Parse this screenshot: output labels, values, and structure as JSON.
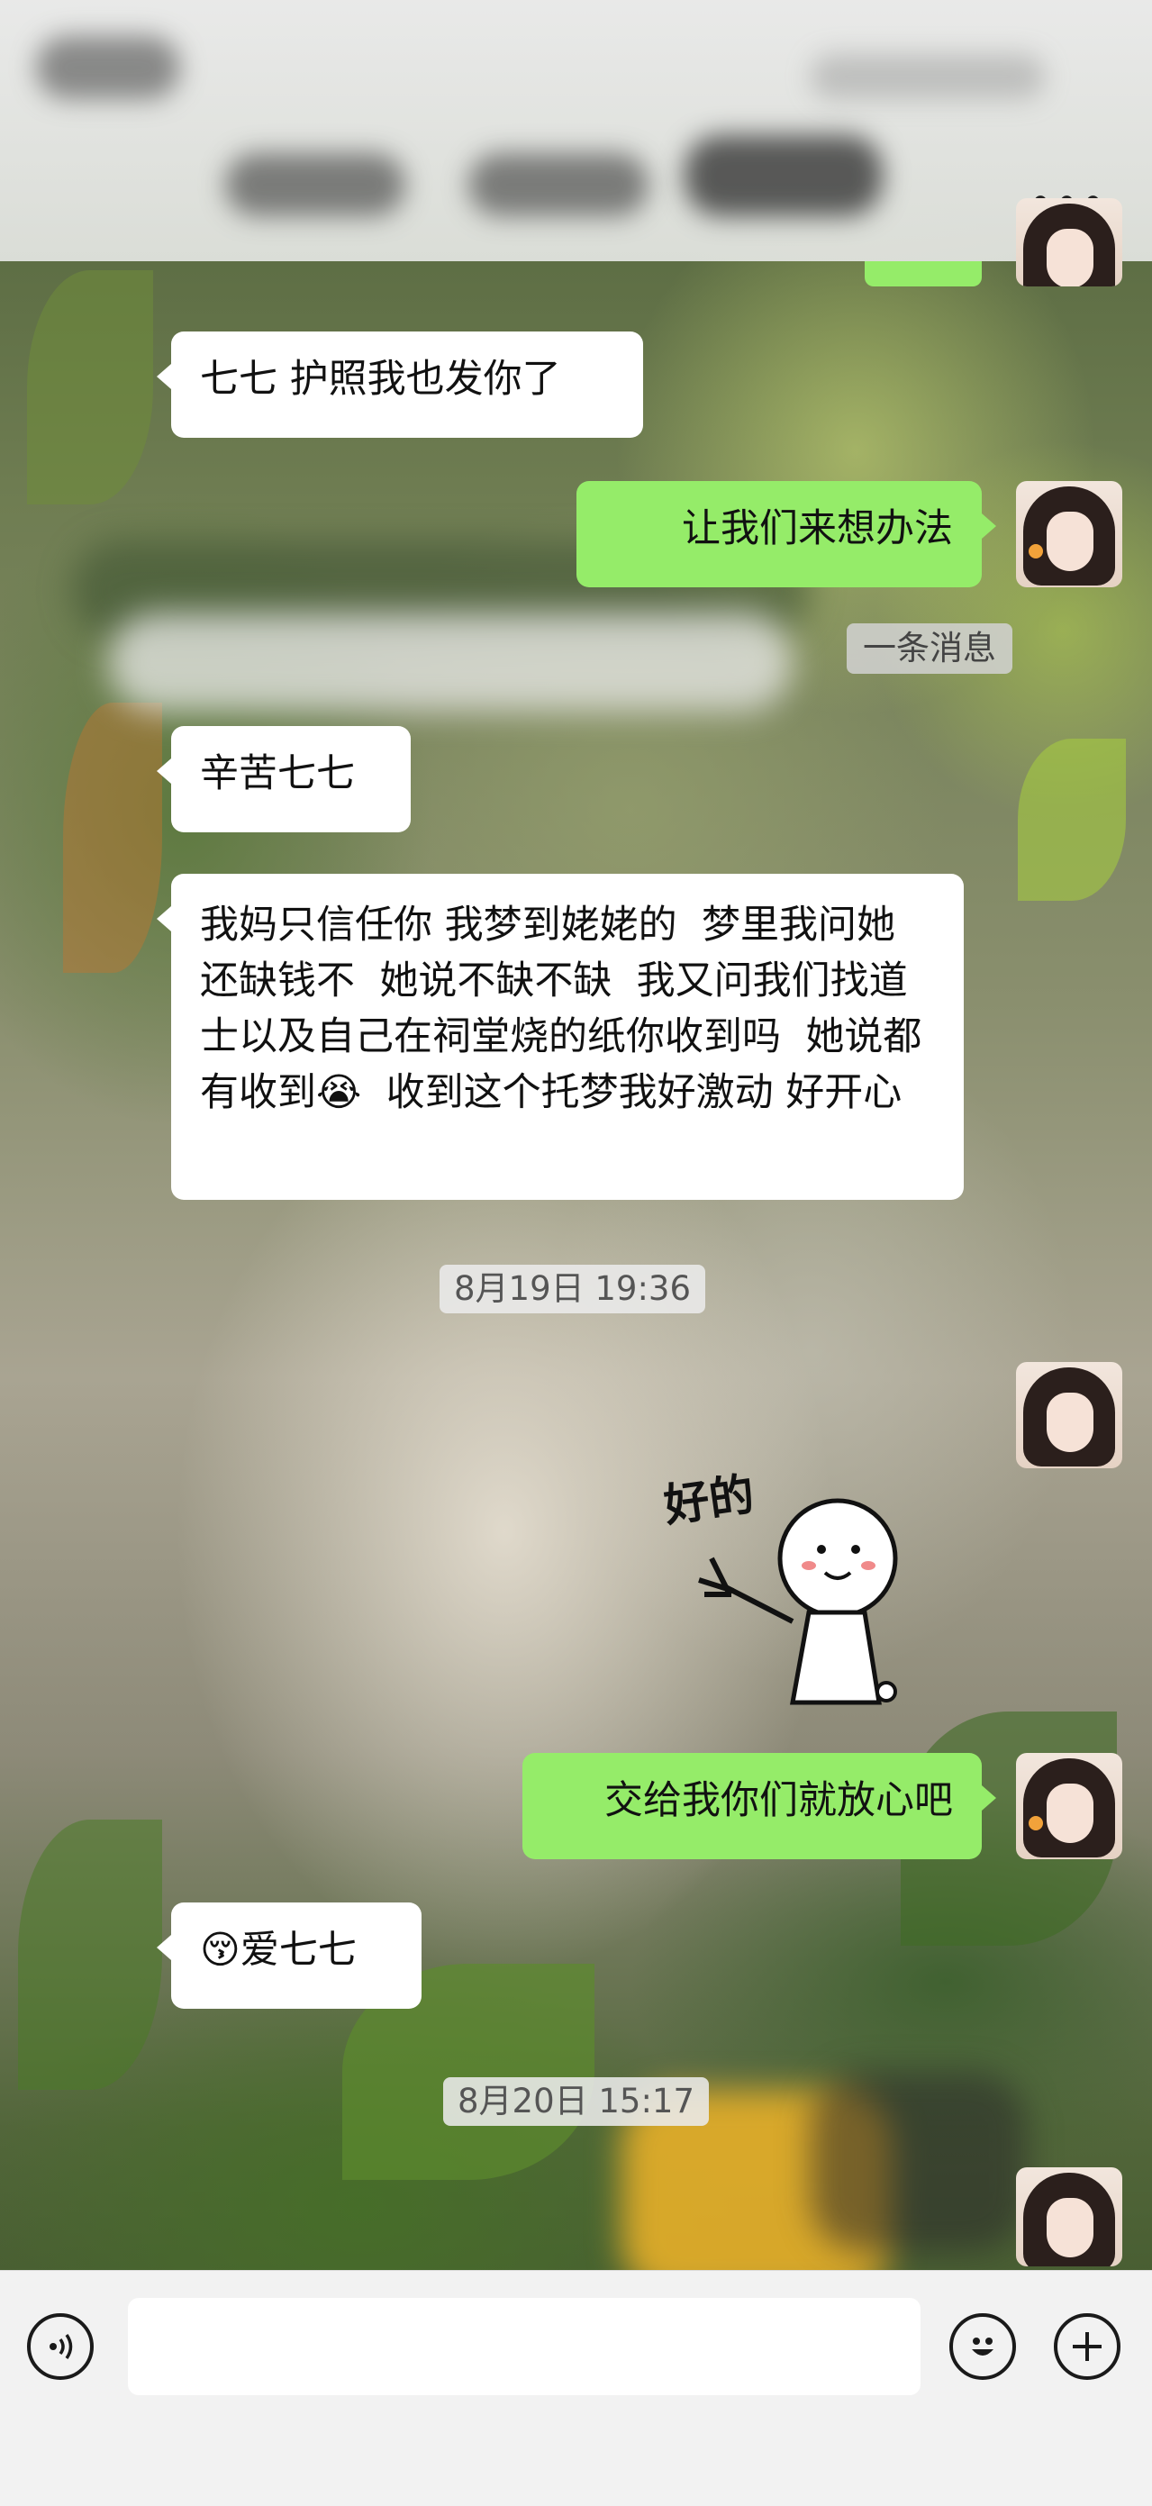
{
  "header": {
    "more_label": "•••",
    "more_icon": "more-dots-icon"
  },
  "messages": [
    {
      "id": "m1",
      "side": "in",
      "text": "七七 护照我也发你了"
    },
    {
      "id": "m2",
      "side": "out",
      "text": "让我们来想办法"
    },
    {
      "id": "m3",
      "side": "in",
      "text": "辛苦七七"
    },
    {
      "id": "m4",
      "side": "in",
      "text": "我妈只信任你 我梦到姥姥的  梦里我问她 还缺钱不  她说不缺不缺  我又问我们找道士以及自己在祠堂烧的纸你收到吗  她说都有收到😭  收到这个托梦我好激动 好开心"
    },
    {
      "id": "m5",
      "side": "out",
      "text": "交给我你们就放心吧"
    },
    {
      "id": "m6",
      "side": "in",
      "text": "😚爱七七"
    }
  ],
  "system_note": "一条消息",
  "timestamps": [
    "8月19日 19:36",
    "8月20日 15:17"
  ],
  "sticker": {
    "text": "好的",
    "icon": "ok-sticker-icon"
  },
  "input_bar": {
    "voice_icon": "voice-icon",
    "emoji_icon": "emoji-icon",
    "plus_icon": "plus-icon",
    "input_value": ""
  },
  "colors": {
    "outgoing_bubble": "#95ec69",
    "incoming_bubble": "#ffffff",
    "input_bar_bg": "#f2f2f2"
  }
}
